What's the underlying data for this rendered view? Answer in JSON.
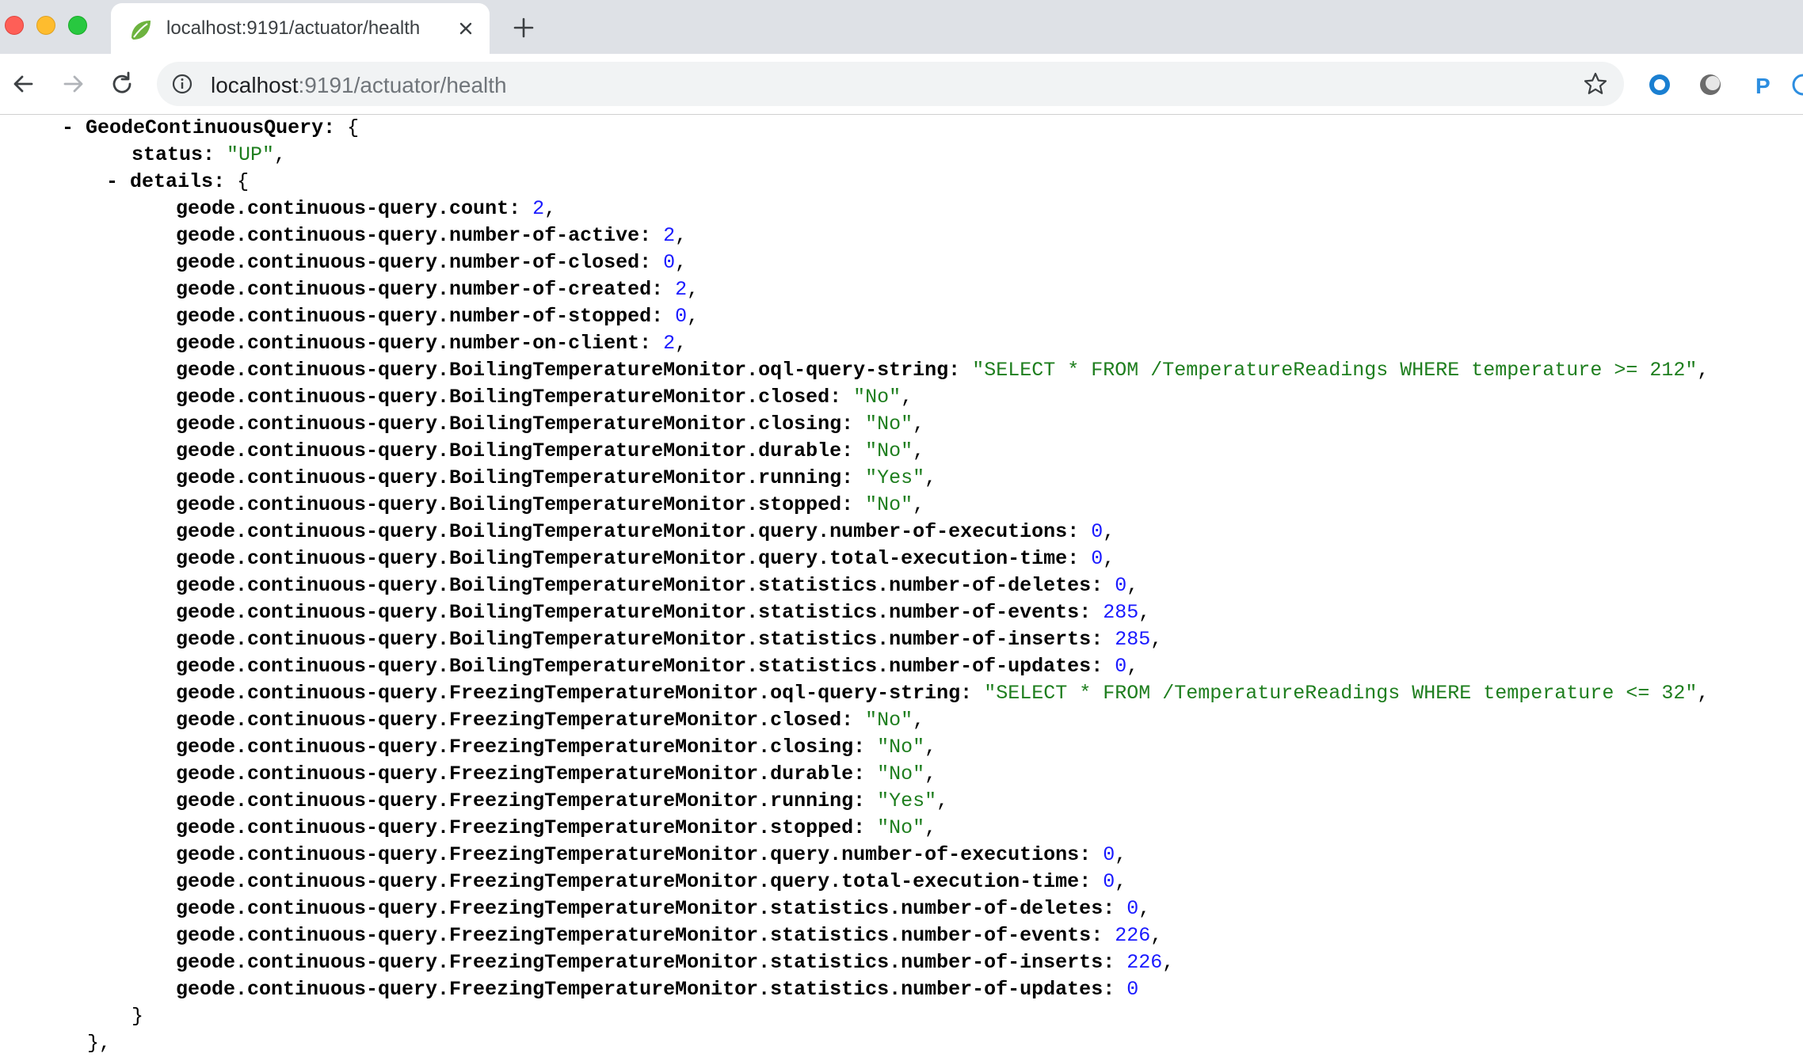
{
  "browser": {
    "tab_title": "localhost:9191/actuator/health",
    "url_host": "localhost",
    "url_rest": ":9191/actuator/health",
    "favicon": "spring-leaf-icon",
    "extensions": [
      "circle-ring-icon",
      "gray-orb-icon",
      "p-extension-icon"
    ]
  },
  "json": {
    "node_key": "GeodeContinuousQuery",
    "status_key": "status",
    "status_value": "\"UP\"",
    "details_key": "details",
    "open_brace": "{",
    "toggle": "-",
    "entries": [
      {
        "k": "geode.continuous-query.count",
        "v": "2",
        "t": "num",
        "comma": ","
      },
      {
        "k": "geode.continuous-query.number-of-active",
        "v": "2",
        "t": "num",
        "comma": ","
      },
      {
        "k": "geode.continuous-query.number-of-closed",
        "v": "0",
        "t": "num",
        "comma": ","
      },
      {
        "k": "geode.continuous-query.number-of-created",
        "v": "2",
        "t": "num",
        "comma": ","
      },
      {
        "k": "geode.continuous-query.number-of-stopped",
        "v": "0",
        "t": "num",
        "comma": ","
      },
      {
        "k": "geode.continuous-query.number-on-client",
        "v": "2",
        "t": "num",
        "comma": ","
      },
      {
        "k": "geode.continuous-query.BoilingTemperatureMonitor.oql-query-string",
        "v": "\"SELECT * FROM /TemperatureReadings WHERE temperature >= 212\"",
        "t": "str",
        "comma": ","
      },
      {
        "k": "geode.continuous-query.BoilingTemperatureMonitor.closed",
        "v": "\"No\"",
        "t": "str",
        "comma": ","
      },
      {
        "k": "geode.continuous-query.BoilingTemperatureMonitor.closing",
        "v": "\"No\"",
        "t": "str",
        "comma": ","
      },
      {
        "k": "geode.continuous-query.BoilingTemperatureMonitor.durable",
        "v": "\"No\"",
        "t": "str",
        "comma": ","
      },
      {
        "k": "geode.continuous-query.BoilingTemperatureMonitor.running",
        "v": "\"Yes\"",
        "t": "str",
        "comma": ","
      },
      {
        "k": "geode.continuous-query.BoilingTemperatureMonitor.stopped",
        "v": "\"No\"",
        "t": "str",
        "comma": ","
      },
      {
        "k": "geode.continuous-query.BoilingTemperatureMonitor.query.number-of-executions",
        "v": "0",
        "t": "num",
        "comma": ","
      },
      {
        "k": "geode.continuous-query.BoilingTemperatureMonitor.query.total-execution-time",
        "v": "0",
        "t": "num",
        "comma": ","
      },
      {
        "k": "geode.continuous-query.BoilingTemperatureMonitor.statistics.number-of-deletes",
        "v": "0",
        "t": "num",
        "comma": ","
      },
      {
        "k": "geode.continuous-query.BoilingTemperatureMonitor.statistics.number-of-events",
        "v": "285",
        "t": "num",
        "comma": ","
      },
      {
        "k": "geode.continuous-query.BoilingTemperatureMonitor.statistics.number-of-inserts",
        "v": "285",
        "t": "num",
        "comma": ","
      },
      {
        "k": "geode.continuous-query.BoilingTemperatureMonitor.statistics.number-of-updates",
        "v": "0",
        "t": "num",
        "comma": ","
      },
      {
        "k": "geode.continuous-query.FreezingTemperatureMonitor.oql-query-string",
        "v": "\"SELECT * FROM /TemperatureReadings WHERE temperature <= 32\"",
        "t": "str",
        "comma": ","
      },
      {
        "k": "geode.continuous-query.FreezingTemperatureMonitor.closed",
        "v": "\"No\"",
        "t": "str",
        "comma": ","
      },
      {
        "k": "geode.continuous-query.FreezingTemperatureMonitor.closing",
        "v": "\"No\"",
        "t": "str",
        "comma": ","
      },
      {
        "k": "geode.continuous-query.FreezingTemperatureMonitor.durable",
        "v": "\"No\"",
        "t": "str",
        "comma": ","
      },
      {
        "k": "geode.continuous-query.FreezingTemperatureMonitor.running",
        "v": "\"Yes\"",
        "t": "str",
        "comma": ","
      },
      {
        "k": "geode.continuous-query.FreezingTemperatureMonitor.stopped",
        "v": "\"No\"",
        "t": "str",
        "comma": ","
      },
      {
        "k": "geode.continuous-query.FreezingTemperatureMonitor.query.number-of-executions",
        "v": "0",
        "t": "num",
        "comma": ","
      },
      {
        "k": "geode.continuous-query.FreezingTemperatureMonitor.query.total-execution-time",
        "v": "0",
        "t": "num",
        "comma": ","
      },
      {
        "k": "geode.continuous-query.FreezingTemperatureMonitor.statistics.number-of-deletes",
        "v": "0",
        "t": "num",
        "comma": ","
      },
      {
        "k": "geode.continuous-query.FreezingTemperatureMonitor.statistics.number-of-events",
        "v": "226",
        "t": "num",
        "comma": ","
      },
      {
        "k": "geode.continuous-query.FreezingTemperatureMonitor.statistics.number-of-inserts",
        "v": "226",
        "t": "num",
        "comma": ","
      },
      {
        "k": "geode.continuous-query.FreezingTemperatureMonitor.statistics.number-of-updates",
        "v": "0",
        "t": "num",
        "comma": ""
      }
    ],
    "close_details": "}",
    "close_node": "},"
  },
  "colors": {
    "string": "#1e7e1e",
    "number": "#1a1aff",
    "chrome_bg": "#dee1e6",
    "omnibox_bg": "#f1f3f4"
  }
}
